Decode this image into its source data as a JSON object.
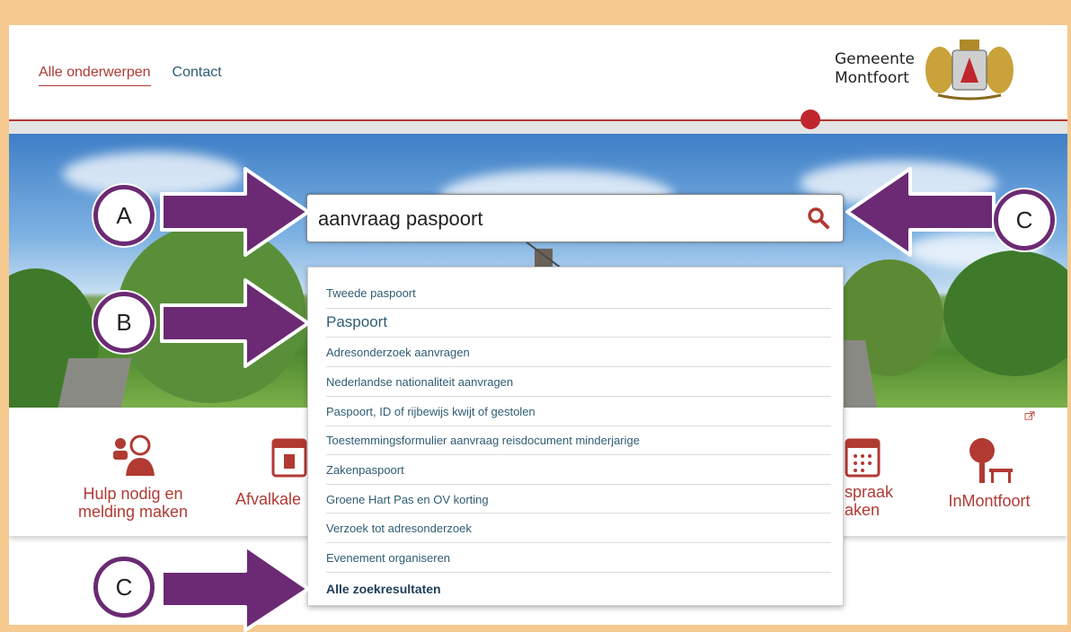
{
  "nav": {
    "items": [
      {
        "label": "Alle onderwerpen",
        "active": true
      },
      {
        "label": "Contact",
        "active": false
      }
    ]
  },
  "logo": {
    "line1": "Gemeente",
    "line2": "Montfoort"
  },
  "search": {
    "value": "aanvraag paspoort",
    "icon": "search-icon"
  },
  "suggestions": [
    "Tweede paspoort",
    "Paspoort",
    "Adresonderzoek aanvragen",
    "Nederlandse nationaliteit aanvragen",
    "Paspoort, ID of rijbewijs kwijt of gestolen",
    "Toestemmingsformulier aanvraag reisdocument minderjarige",
    "Zakenpaspoort",
    "Groene Hart Pas en OV korting",
    "Verzoek tot adresonderzoek",
    "Evenement organiseren",
    "Alle zoekresultaten"
  ],
  "tiles": [
    {
      "label": "Hulp nodig en melding maken",
      "line1": "Hulp nodig en",
      "line2": "melding maken",
      "icon": "people-icon"
    },
    {
      "label": "Afvalkalender",
      "line1": "Afvalkale",
      "icon": "calendar-icon"
    },
    {
      "label": "Afspraak maken",
      "line1": "spraak",
      "line2": "aken",
      "icon": "calendar-grid-icon"
    },
    {
      "label": "InMontfoort",
      "line1": "InMontfoort",
      "icon": "tree-bench-icon"
    }
  ],
  "annotations": {
    "a": "A",
    "b": "B",
    "c_top": "C",
    "c_bottom": "C"
  },
  "colors": {
    "brand_red": "#b13a33",
    "link_blue": "#2f5d73",
    "annotation_purple": "#6b2a73",
    "frame_tan": "#f5c98f"
  }
}
